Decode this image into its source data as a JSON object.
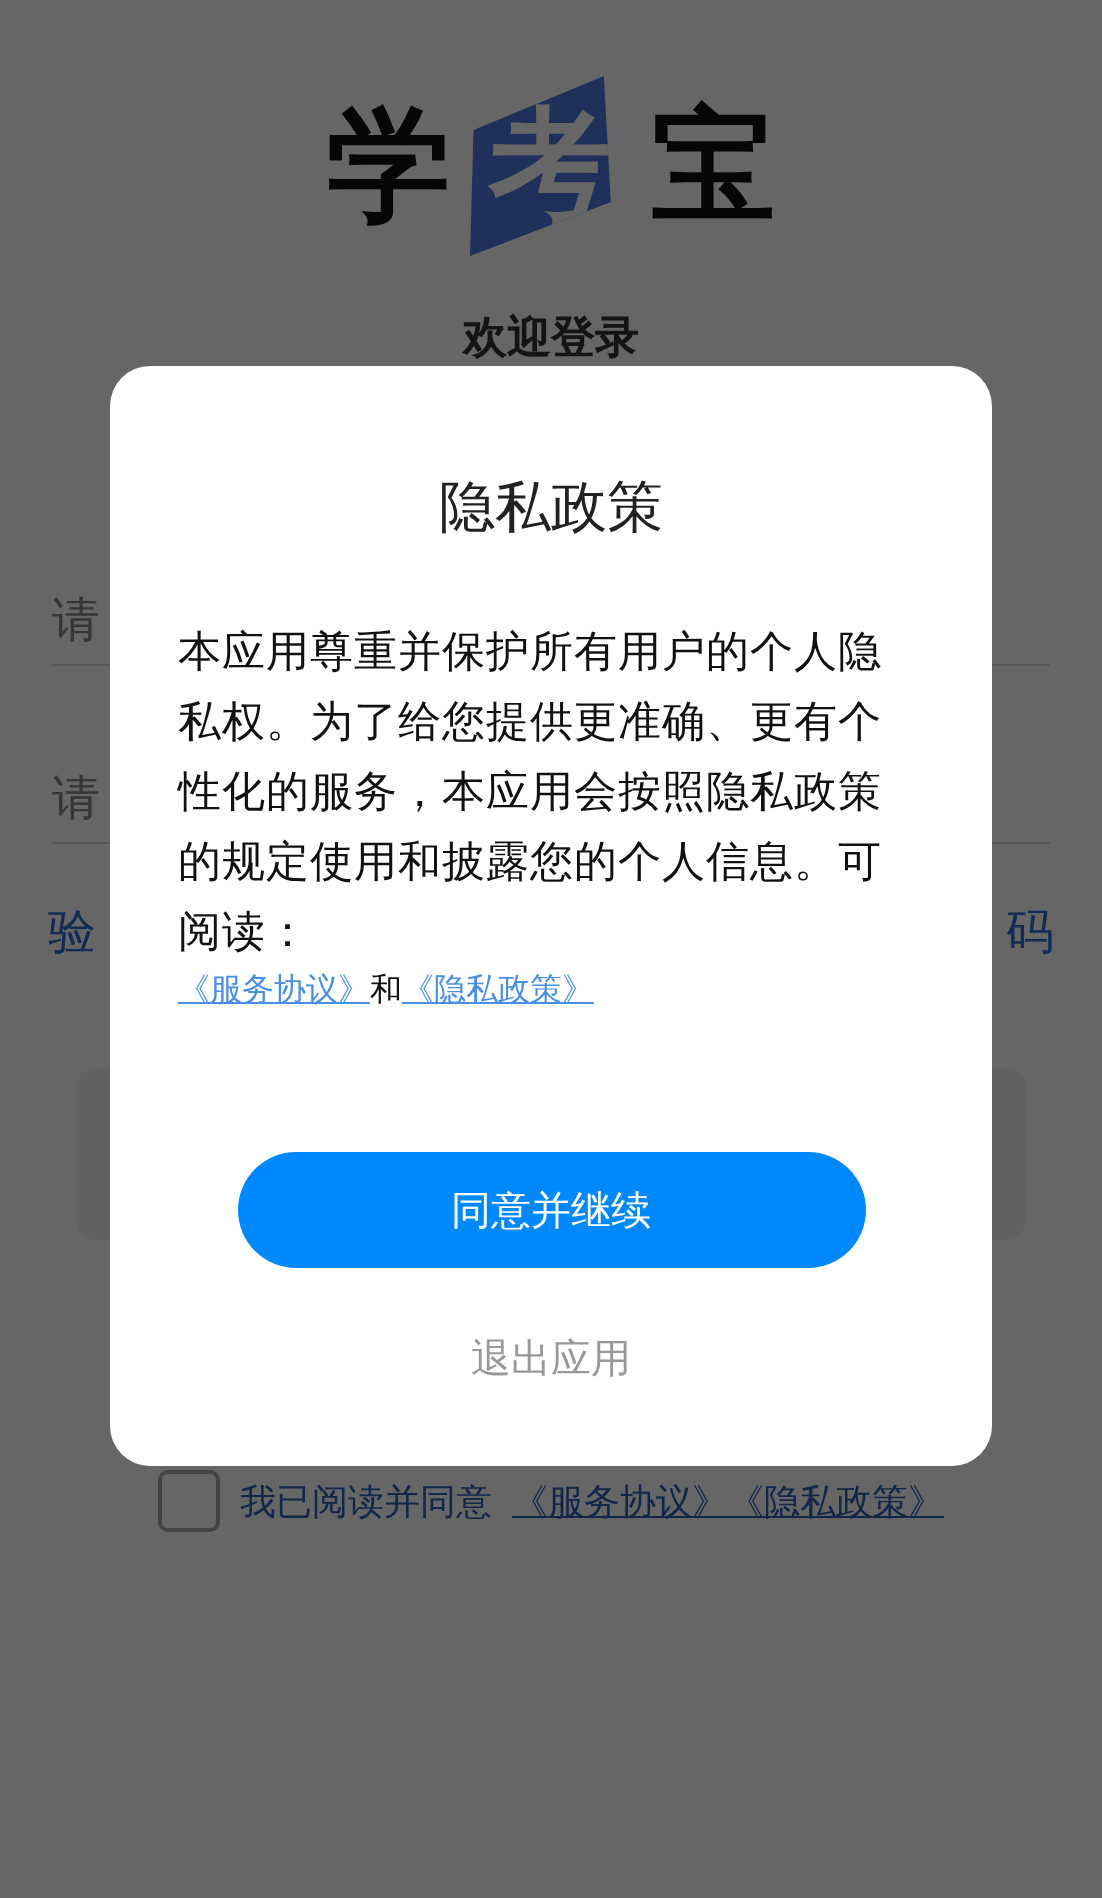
{
  "logo": {
    "letters": [
      "学",
      "考",
      "宝"
    ]
  },
  "welcome": "欢迎登录",
  "fields": [
    {
      "placeholder": "请"
    },
    {
      "placeholder": "请"
    }
  ],
  "code_row": {
    "left": "验",
    "right": "码"
  },
  "agreement": {
    "checked": false,
    "text": "我已阅读并同意",
    "links": [
      "《服务协议》",
      "《隐私政策》"
    ]
  },
  "dialog": {
    "title": "隐私政策",
    "body": "本应用尊重并保护所有用户的个人隐私权。为了给您提供更准确、更有个性化的服务，本应用会按照隐私政策的规定使用和披露您的个人信息。可阅读：",
    "links": [
      {
        "text": "《服务协议》"
      },
      {
        "text": "《隐私政策》"
      }
    ],
    "joiner": "和",
    "buttons": [
      {
        "kind": "primary",
        "label": "同意并继续"
      },
      {
        "kind": "text",
        "label": "退出应用"
      }
    ]
  }
}
